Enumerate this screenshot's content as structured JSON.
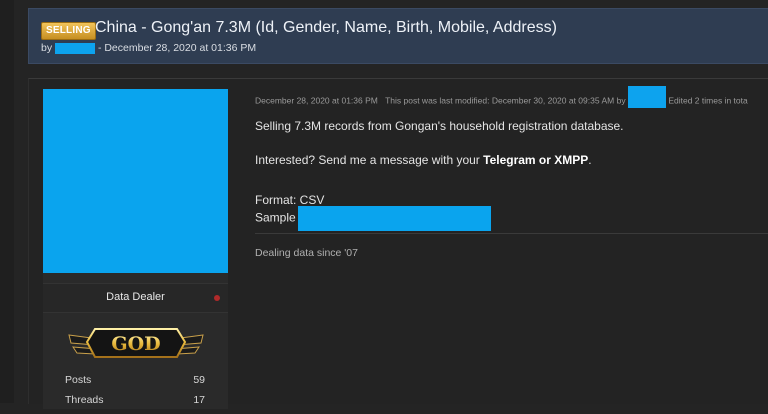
{
  "thread": {
    "tag": "SELLING",
    "title": "China - Gong'an 7.3M (Id, Gender, Name, Birth, Mobile, Address)",
    "by_prefix": "by",
    "date": "- December 28, 2020 at 01:36 PM"
  },
  "profile": {
    "user_title": "Data Dealer",
    "rank_label": "GOD",
    "stats": [
      {
        "label": "Posts",
        "value": "59"
      },
      {
        "label": "Threads",
        "value": "17"
      }
    ]
  },
  "post": {
    "date": "December 28, 2020 at 01:36 PM",
    "modified_text": "This post was last modified: December 30, 2020 at 09:35 AM by",
    "edited_text": "Edited 2 times in tota",
    "lines": {
      "intro": "Selling 7.3M records from Gongan's household registration database.",
      "contact_prefix": "Interested? Send me a message with your ",
      "contact_bold": "Telegram or XMPP",
      "contact_suffix": ".",
      "format": "Format: CSV",
      "sample": "Sample"
    },
    "signature": "Dealing data since '07"
  },
  "colors": {
    "header_bg": "#2f3d52",
    "redaction": "#0aa4ee",
    "tag_gold": "#e0a83a",
    "status_red": "#b02a2a"
  }
}
